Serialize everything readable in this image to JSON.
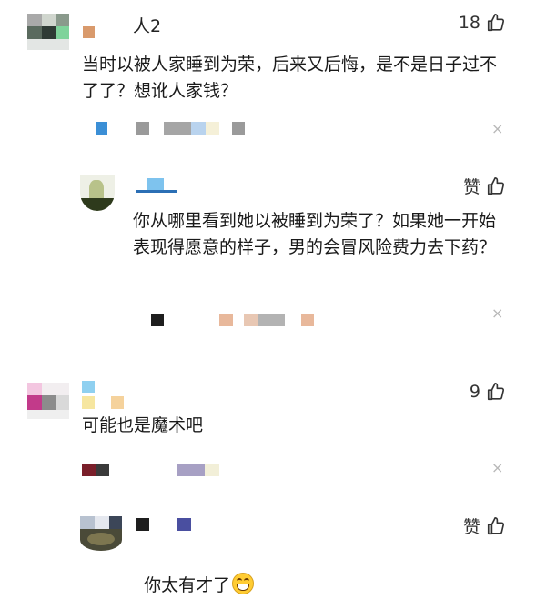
{
  "comments": [
    {
      "name": "人2",
      "likes": "18",
      "text": "当时以被人家睡到为荣，后来又后悔，是不是日子过不了了？想讹人家钱？",
      "replies": [
        {
          "likes": "赞",
          "text": "你从哪里看到她以被睡到为荣了？如果她一开始表现得愿意的样子，男的会冒风险费力去下药？"
        }
      ]
    },
    {
      "likes": "9",
      "text": "可能也是魔术吧",
      "replies": [
        {
          "likes": "赞",
          "text": "你太有才了",
          "emoji": "grin-emoji"
        }
      ]
    }
  ],
  "close_glyph": "×",
  "icons": {
    "like": "thumbs-up-icon",
    "close": "close-icon"
  }
}
